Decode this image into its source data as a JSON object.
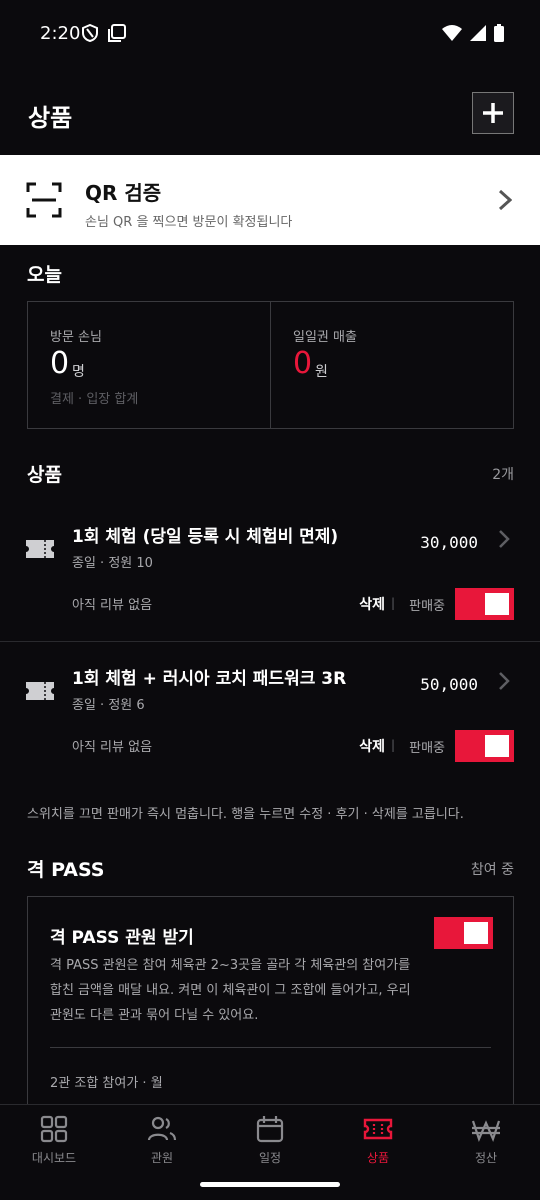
{
  "status_bar": {
    "time": "2:20"
  },
  "header": {
    "title": "상품",
    "add_icon": "plus-icon"
  },
  "qr": {
    "title": "QR 검증",
    "subtitle": "손님 QR 을 찍으면 방문이 확정됩니다"
  },
  "today": {
    "title": "오늘",
    "visitors_label": "방문 손님",
    "visitors_value": "0",
    "visitors_unit": "명",
    "visitors_foot": "결제 · 입장 합계",
    "sales_label": "일일권 매출",
    "sales_value": "0",
    "sales_unit": "원"
  },
  "products": {
    "title": "상품",
    "count": "2개",
    "items": [
      {
        "name": "1회 체험 (당일 등록 시 체험비 면제)",
        "meta": "종일 · 정원 10",
        "price": "30,000",
        "review": "아직 리뷰 없음",
        "delete": "삭제",
        "sale": "판매중",
        "on_sale": true
      },
      {
        "name": "1회 체험 + 러시아 코치 패드워크 3R",
        "meta": "종일 · 정원 6",
        "price": "50,000",
        "review": "아직 리뷰 없음",
        "delete": "삭제",
        "sale": "판매중",
        "on_sale": true
      }
    ],
    "hint": "스위치를 끄면 판매가 즉시 멈춥니다. 행을 누르면 수정 · 후기 · 삭제를 고릅니다."
  },
  "pass": {
    "title": "격 PASS",
    "status": "참여 중",
    "card_title": "격 PASS 관원 받기",
    "desc": "격 PASS 관원은 참여 체육관 2~3곳을 골라 각 체육관의 참여가를 합친 금액을 매달 내요. 켜면 이 체육관이 그 조합에 들어가고, 우리 관원도 다른 관과 묶어 다닐 수 있어요.",
    "sub": "2관 조합 참여가 · 월",
    "enabled": true
  },
  "nav": [
    {
      "label": "대시보드",
      "icon": "grid-icon"
    },
    {
      "label": "관원",
      "icon": "users-icon"
    },
    {
      "label": "일정",
      "icon": "calendar-icon"
    },
    {
      "label": "상품",
      "icon": "ticket-icon",
      "active": true
    },
    {
      "label": "정산",
      "icon": "won-icon"
    }
  ],
  "colors": {
    "accent": "#e8173a",
    "background": "#0b0a0d",
    "card": "#ffffff"
  }
}
